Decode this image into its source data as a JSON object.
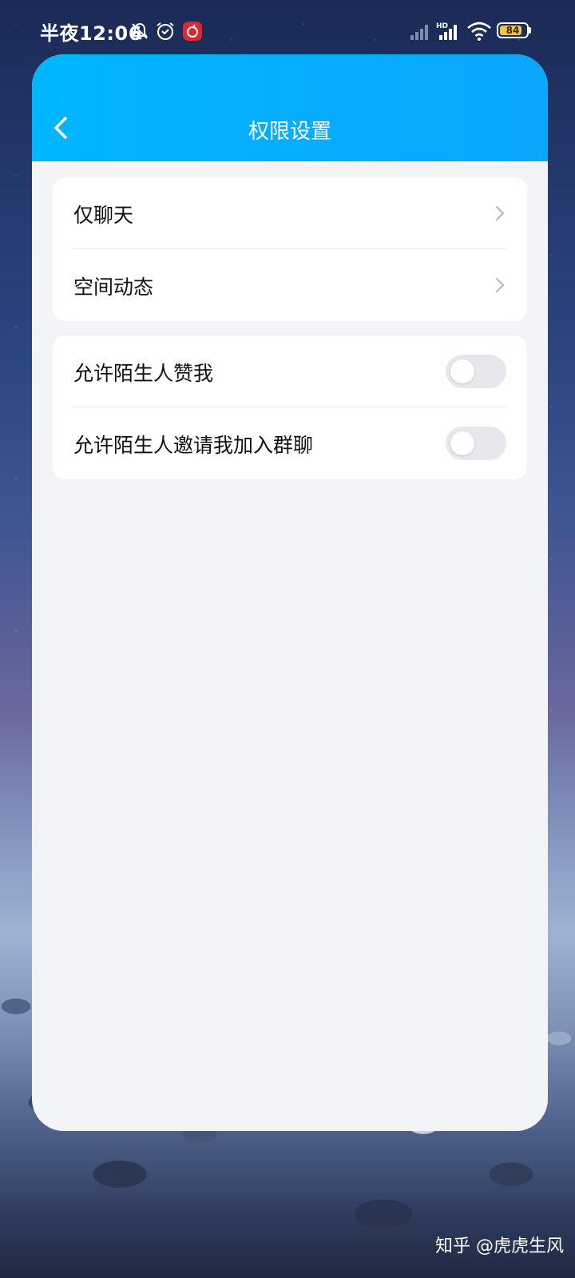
{
  "status_bar": {
    "time": "半夜12:06",
    "icons": [
      "notification-off-icon",
      "alarm-icon",
      "netease-music-icon",
      "signal-icon",
      "hd-signal-icon",
      "wifi-icon"
    ],
    "battery": "84",
    "battery_level": 0.84
  },
  "header": {
    "title": "权限设置",
    "back_icon": "chevron-left-icon"
  },
  "sections": [
    {
      "items": [
        {
          "label": "仅聊天",
          "type": "link"
        },
        {
          "label": "空间动态",
          "type": "link"
        }
      ]
    },
    {
      "items": [
        {
          "label": "允许陌生人赞我",
          "type": "toggle",
          "on": false
        },
        {
          "label": "允许陌生人邀请我加入群聊",
          "type": "toggle",
          "on": false
        }
      ]
    }
  ],
  "colors": {
    "header_start": "#00b6ff",
    "header_end": "#0aa6ff",
    "toggle_off": "#e6e8ee",
    "page_bg": "#f3f4f8"
  },
  "watermark": "知乎 @虎虎生风"
}
